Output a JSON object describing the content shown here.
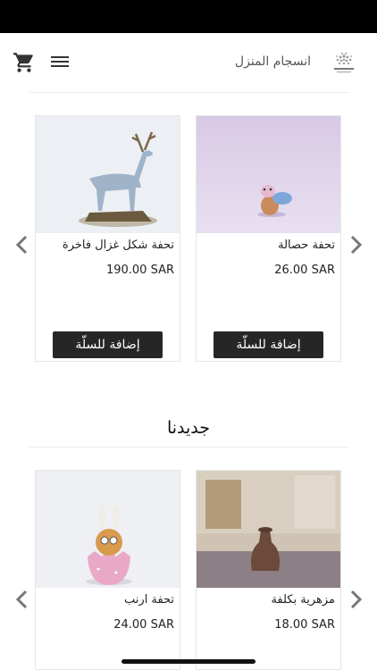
{
  "header": {
    "brand_name": "انسجام المنزل",
    "logo_text": "انسجام المنزل"
  },
  "featured": {
    "products": [
      {
        "name": "تحفة حصالة",
        "price": "26.00 SAR",
        "add_label": "إضافة للسلّة"
      },
      {
        "name": "تحفة شكل غزال فاخرة",
        "price": "190.00 SAR",
        "add_label": "إضافة للسلّة"
      }
    ]
  },
  "new_arrivals": {
    "title": "جديدنا",
    "products": [
      {
        "name": "مزهرية بكلفة",
        "price": "18.00 SAR"
      },
      {
        "name": "تحفة ارنب",
        "price": "24.00 SAR"
      }
    ]
  },
  "colors": {
    "button_bg": "#262626",
    "status_bar": "#000000",
    "accent_icon": "#333333"
  },
  "icons": [
    "cart-icon",
    "menu-icon",
    "brand-logo-icon",
    "chevron-left-icon",
    "chevron-right-icon"
  ]
}
